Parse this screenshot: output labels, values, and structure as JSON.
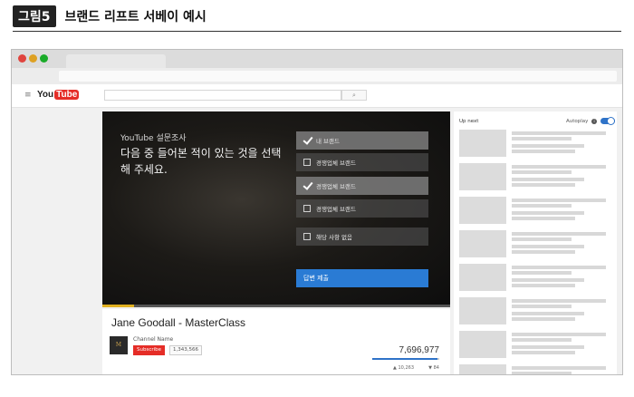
{
  "figure": {
    "tag": "그림5",
    "title": "브랜드 리프트 서베이 예시"
  },
  "youtube": {
    "logo_you": "You",
    "logo_tube": "Tube",
    "search_icon": "search-icon"
  },
  "survey": {
    "brand_label": "YouTube 설문조사",
    "question": "다음 중 들어본 적이 있는 것을 선택해 주세요.",
    "options": [
      {
        "label": "내 브랜드",
        "checked": true
      },
      {
        "label": "경쟁업체 브랜드",
        "checked": false
      },
      {
        "label": "경쟁업체 브랜드",
        "checked": true
      },
      {
        "label": "경쟁업체 브랜드",
        "checked": false
      },
      {
        "label": "해당 사항 없음",
        "checked": false
      }
    ],
    "submit_label": "답변 제출",
    "submit_color": "#2a7bd4",
    "progress_fraction": 0.09
  },
  "video": {
    "title": "Jane Goodall - MasterClass",
    "channel_name": "Channel Name",
    "channel_avatar": "M",
    "subscribe_label": "Subscribe",
    "subscriber_count": "1,343,566",
    "view_count": "7,696,977",
    "like_fraction": 0.97,
    "likes": "10,263",
    "dislikes": "84"
  },
  "sidebar": {
    "upnext_label": "Up next",
    "autoplay_label": "Autoplay",
    "autoplay_on": true,
    "recommended_count": 8
  },
  "colors": {
    "accent": "#2f73c8",
    "subscribe": "#e52d27",
    "progress": "#e0b020"
  }
}
